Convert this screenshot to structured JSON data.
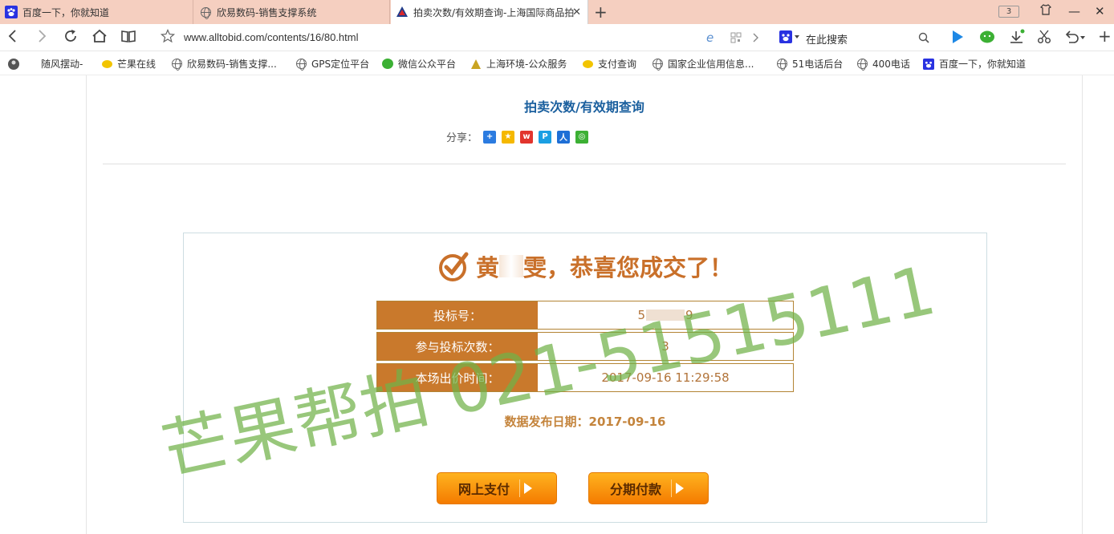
{
  "browser": {
    "tabs": [
      {
        "title": "百度一下，你就知道",
        "icon": "baidu-paw-icon"
      },
      {
        "title": "欣易数码-销售支撑系统",
        "icon": "globe-icon"
      },
      {
        "title": "拍卖次数/有效期查询-上海国际商品拍",
        "icon": "site-triangle-icon",
        "active": true
      }
    ],
    "tab_count": "3",
    "address": {
      "url": "www.alltobid.com/contents/16/80.html",
      "search_placeholder": "在此搜索"
    },
    "bookmarks": [
      {
        "label": "随风摆动-",
        "icon": "avatar-icon"
      },
      {
        "label": "芒果在线",
        "icon": "mango-icon"
      },
      {
        "label": "欣易数码-销售支撑...",
        "icon": "globe-icon"
      },
      {
        "label": "GPS定位平台",
        "icon": "globe-icon"
      },
      {
        "label": "微信公众平台",
        "icon": "wechat-icon"
      },
      {
        "label": "上海环境-公众服务",
        "icon": "shanghai-env-icon"
      },
      {
        "label": "支付查询",
        "icon": "mango-icon"
      },
      {
        "label": "国家企业信用信息...",
        "icon": "globe-icon"
      },
      {
        "label": "51电话后台",
        "icon": "globe-icon"
      },
      {
        "label": "400电话",
        "icon": "globe-icon"
      },
      {
        "label": "百度一下，你就知道",
        "icon": "baidu-paw-icon"
      }
    ]
  },
  "page": {
    "title": "拍卖次数/有效期查询",
    "share_label": "分享：",
    "result": {
      "name_first": "黄",
      "name_last": "雯",
      "congrats": "，恭喜您成交了！",
      "rows": [
        {
          "label": "投标号：",
          "value_prefix": "5",
          "value_suffix": "9"
        },
        {
          "label": "参与投标次数：",
          "value": "3"
        },
        {
          "label": "本场出价时间：",
          "value": "2017-09-16 11:29:58"
        }
      ],
      "release_label": "数据发布日期：",
      "release_date": "2017-09-16",
      "buttons": {
        "pay_online": "网上支付",
        "installment": "分期付款"
      }
    },
    "watermark": "芒果帮拍 021-51515111"
  },
  "colors": {
    "tab_strip": "#f5cfc0",
    "title_blue": "#1a5f9e",
    "label_orange": "#c9792c",
    "value_brown": "#b2743a",
    "button_orange": "#f47b00",
    "watermark_green": "#70b248"
  }
}
